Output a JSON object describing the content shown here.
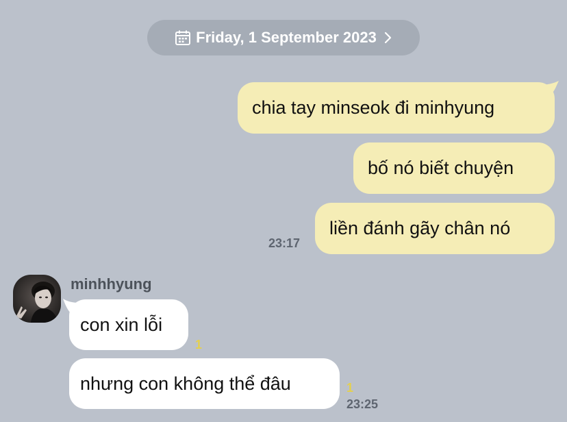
{
  "date_pill": {
    "text": "Friday, 1 September 2023"
  },
  "outgoing": [
    {
      "text": "chia tay minseok đi minhyung"
    },
    {
      "text": "bố nó biết chuyện"
    },
    {
      "text": "liền đánh gãy chân nó"
    }
  ],
  "outgoing_time": "23:17",
  "sender_name": "minhhyung",
  "incoming": [
    {
      "text": "con xin lỗi",
      "unread": "1"
    },
    {
      "text": "nhưng con không thể đâu",
      "unread": "1"
    }
  ],
  "incoming_time": "23:25",
  "colors": {
    "background": "#bbc1cb",
    "outgoing_bubble": "#f5edb6",
    "incoming_bubble": "#ffffff",
    "date_pill": "#a5acb6",
    "unread_count": "#e4d04e"
  }
}
